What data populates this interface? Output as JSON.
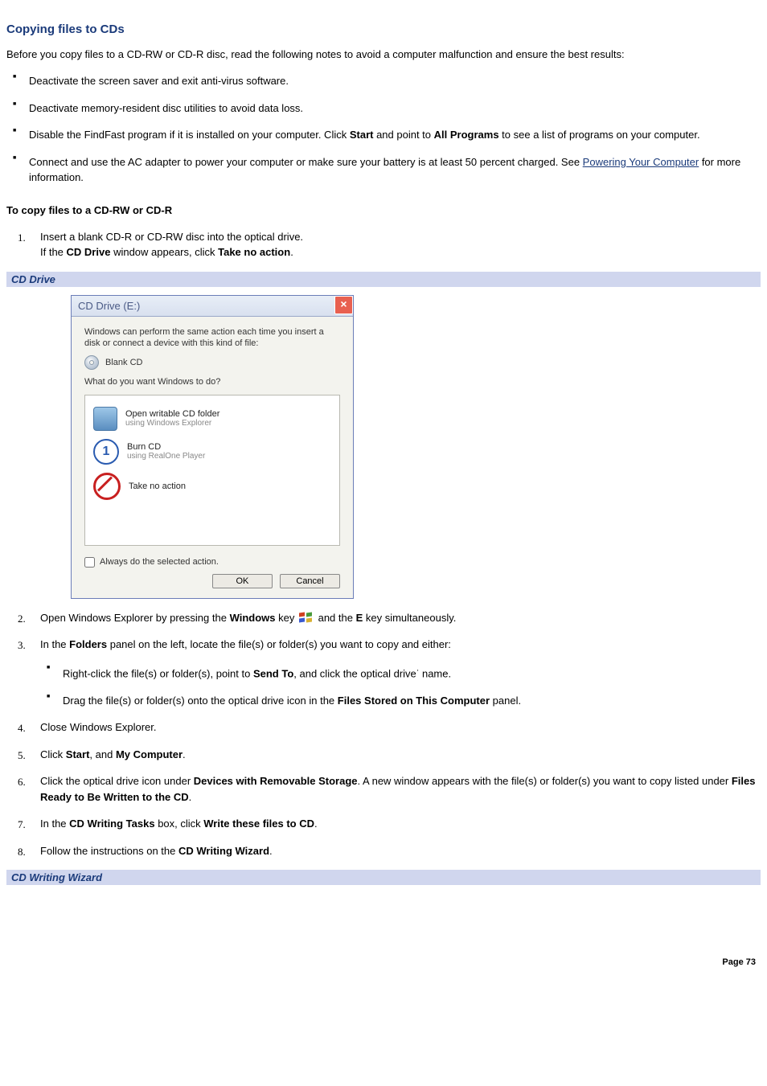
{
  "heading": "Copying files to CDs",
  "intro": "Before you copy files to a CD-RW or CD-R disc, read the following notes to avoid a computer malfunction and ensure the best results:",
  "bullets": {
    "b1": "Deactivate the screen saver and exit anti-virus software.",
    "b2": "Deactivate memory-resident disc utilities to avoid data loss.",
    "b3_pre": "Disable the FindFast program if it is installed on your computer. Click ",
    "b3_start": "Start",
    "b3_mid": " and point to ",
    "b3_allprog": "All Programs",
    "b3_post": " to see a list of programs on your computer.",
    "b4_pre": "Connect and use the AC adapter to power your computer or make sure your battery is at least 50 percent charged. See ",
    "b4_link": "Powering Your Computer",
    "b4_post": " for more information."
  },
  "subhead": "To copy files to a CD-RW or CD-R",
  "ol1": {
    "i1a": "Insert a blank CD-R or CD-RW disc into the optical drive.",
    "i1b_pre": "If the ",
    "i1b_cd": "CD Drive",
    "i1b_mid": " window appears, click ",
    "i1b_action": "Take no action",
    "i1b_post": "."
  },
  "bar1": "CD Drive",
  "dialog": {
    "title": "CD Drive (E:)",
    "line1": "Windows can perform the same action each time you insert a disk or connect a device with this kind of file:",
    "blank": "Blank CD",
    "prompt": "What do you want Windows to do?",
    "opt1a": "Open writable CD folder",
    "opt1b": "using Windows Explorer",
    "opt2a": "Burn CD",
    "opt2b": "using RealOne Player",
    "opt3a": "Take no action",
    "checkbox": "Always do the selected action.",
    "ok": "OK",
    "cancel": "Cancel"
  },
  "ol2": {
    "i2_pre": "Open Windows Explorer by pressing the ",
    "i2_win": "Windows",
    "i2_mid": " key ",
    "i2_and": " and the ",
    "i2_e": "E",
    "i2_post": " key simultaneously.",
    "i3_pre": "In the ",
    "i3_folders": "Folders",
    "i3_post": " panel on the left, locate the file(s) or folder(s) you want to copy and either:",
    "i3a_pre": "Right-click the file(s) or folder(s), point to ",
    "i3a_send": "Send To",
    "i3a_post": ", and click the optical drive",
    "i3a_end": " name.",
    "i3b_pre": "Drag the file(s) or folder(s) onto the optical drive icon in the ",
    "i3b_panel": "Files Stored on This Computer",
    "i3b_post": " panel.",
    "i4": "Close Windows Explorer.",
    "i5_pre": "Click ",
    "i5_start": "Start",
    "i5_mid": ", and ",
    "i5_mycomp": "My Computer",
    "i5_post": ".",
    "i6_pre": "Click the optical drive icon under ",
    "i6_dev": "Devices with Removable Storage",
    "i6_mid": ". A new window appears with the file(s) or folder(s) you want to copy listed under ",
    "i6_ready": "Files Ready to Be Written to the CD",
    "i6_post": ".",
    "i7_pre": "In the ",
    "i7_box": "CD Writing Tasks",
    "i7_mid": " box, click ",
    "i7_write": "Write these files to CD",
    "i7_post": ".",
    "i8_pre": "Follow the instructions on the ",
    "i8_wiz": "CD Writing Wizard",
    "i8_post": "."
  },
  "bar2": "CD Writing Wizard",
  "page": "Page 73"
}
